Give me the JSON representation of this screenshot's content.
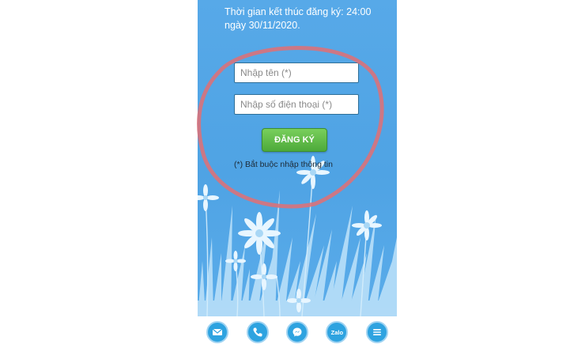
{
  "header": {
    "end_time_text": "Thời gian kết thúc đăng ký: 24:00 ngày 30/11/2020."
  },
  "form": {
    "name_placeholder": "Nhập tên (*)",
    "phone_placeholder": "Nhập số điện thoại (*)",
    "submit_label": "ĐĂNG KÝ",
    "required_note": "(*) Bắt buộc nhập thông tin"
  },
  "bottom_nav": {
    "items": [
      {
        "icon": "email-icon"
      },
      {
        "icon": "phone-icon"
      },
      {
        "icon": "messenger-icon"
      },
      {
        "icon": "zalo-icon",
        "label": "Zalo"
      },
      {
        "icon": "menu-icon"
      }
    ]
  },
  "colors": {
    "background": "#4fa3e4",
    "submit_button": "#4daa3a",
    "highlight_ring": "#d9727a",
    "nav_icon": "#2ea3e0"
  }
}
